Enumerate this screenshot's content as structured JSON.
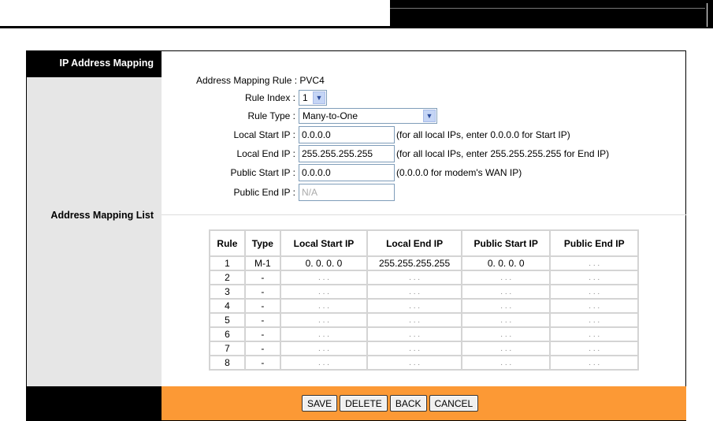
{
  "sidebar": {
    "title": "IP Address Mapping",
    "list_label": "Address Mapping List"
  },
  "form": {
    "mapping_rule_label": "Address Mapping Rule :",
    "mapping_rule_value": "PVC4",
    "rule_index_label": "Rule Index :",
    "rule_index_value": "1",
    "rule_type_label": "Rule Type :",
    "rule_type_value": "Many-to-One",
    "local_start_label": "Local Start IP :",
    "local_start_value": "0.0.0.0",
    "local_start_hint": "(for all local IPs, enter 0.0.0.0 for Start IP)",
    "local_end_label": "Local End IP :",
    "local_end_value": "255.255.255.255",
    "local_end_hint": "(for all local IPs, enter 255.255.255.255 for End IP)",
    "public_start_label": "Public Start IP :",
    "public_start_value": "0.0.0.0",
    "public_start_hint": "(0.0.0.0 for modem's WAN IP)",
    "public_end_label": "Public End IP :",
    "public_end_value": "N/A"
  },
  "table": {
    "headers": [
      "Rule",
      "Type",
      "Local Start IP",
      "Local End IP",
      "Public Start IP",
      "Public End IP"
    ],
    "rows": [
      [
        "1",
        "M-1",
        "0. 0. 0. 0",
        "255.255.255.255",
        "0. 0. 0. 0",
        ". . ."
      ],
      [
        "2",
        "-",
        ". . .",
        ". . .",
        ". . .",
        ". . ."
      ],
      [
        "3",
        "-",
        ". . .",
        ". . .",
        ". . .",
        ". . ."
      ],
      [
        "4",
        "-",
        ". . .",
        ". . .",
        ". . .",
        ". . ."
      ],
      [
        "5",
        "-",
        ". . .",
        ". . .",
        ". . .",
        ". . ."
      ],
      [
        "6",
        "-",
        ". . .",
        ". . .",
        ". . .",
        ". . ."
      ],
      [
        "7",
        "-",
        ". . .",
        ". . .",
        ". . .",
        ". . ."
      ],
      [
        "8",
        "-",
        ". . .",
        ". . .",
        ". . .",
        ". . ."
      ]
    ]
  },
  "buttons": {
    "save": "SAVE",
    "delete": "DELETE",
    "back": "BACK",
    "cancel": "CANCEL"
  },
  "colors": {
    "footer": "#fc9935",
    "sidebar": "#e6e6e6"
  }
}
